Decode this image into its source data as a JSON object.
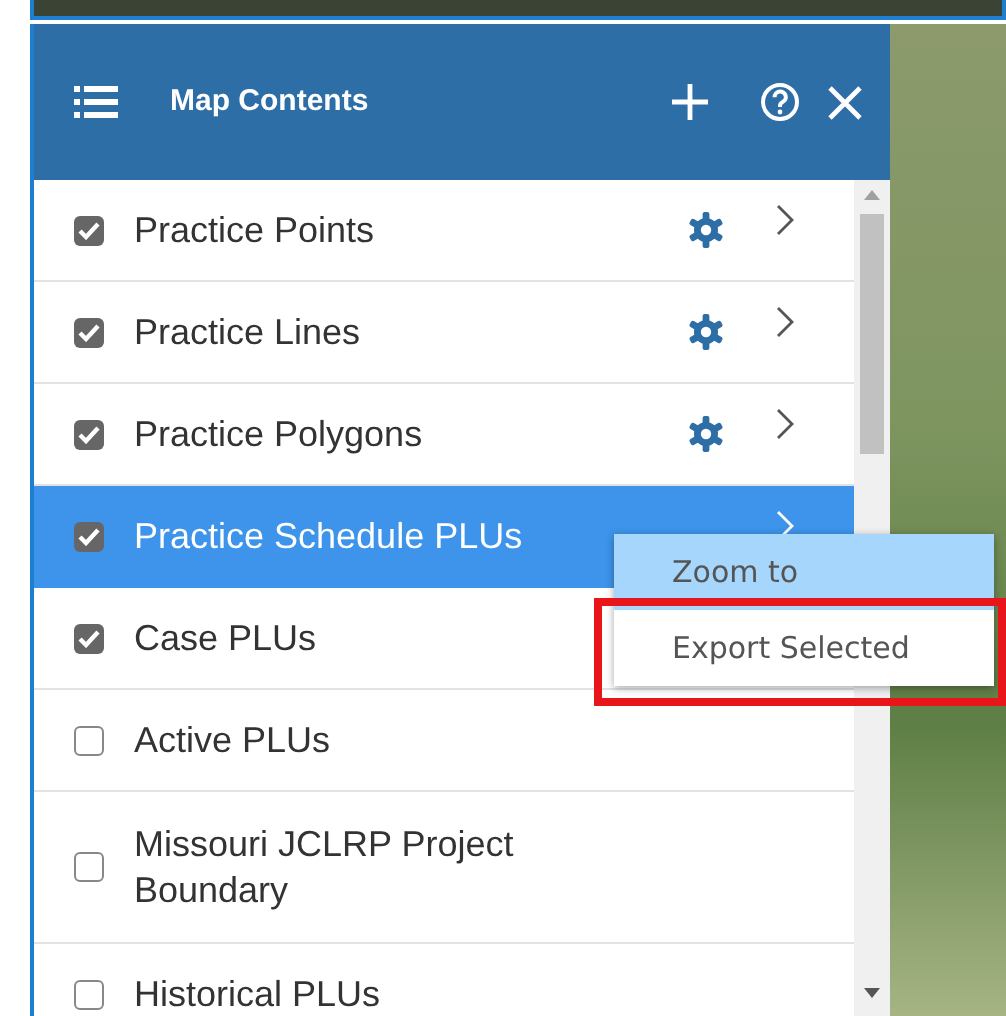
{
  "panel": {
    "title": "Map Contents"
  },
  "layers": [
    {
      "label": "Practice Points",
      "checked": true,
      "selected": false,
      "settings": true,
      "expandable": true
    },
    {
      "label": "Practice Lines",
      "checked": true,
      "selected": false,
      "settings": true,
      "expandable": true
    },
    {
      "label": "Practice Polygons",
      "checked": true,
      "selected": false,
      "settings": true,
      "expandable": true
    },
    {
      "label": "Practice Schedule PLUs",
      "checked": true,
      "selected": true,
      "settings": false,
      "expandable": true
    },
    {
      "label": "Case PLUs",
      "checked": true,
      "selected": false,
      "settings": false,
      "expandable": false
    },
    {
      "label": "Active PLUs",
      "checked": false,
      "selected": false,
      "settings": false,
      "expandable": false
    },
    {
      "label": "Missouri JCLRP Project Boundary",
      "checked": false,
      "selected": false,
      "settings": false,
      "expandable": false
    },
    {
      "label": "Historical PLUs",
      "checked": false,
      "selected": false,
      "settings": false,
      "expandable": false
    }
  ],
  "context_menu": {
    "items": [
      {
        "label": "Zoom to",
        "highlighted": true,
        "outlined": false
      },
      {
        "label": "Export Selected",
        "highlighted": false,
        "outlined": true
      }
    ]
  }
}
